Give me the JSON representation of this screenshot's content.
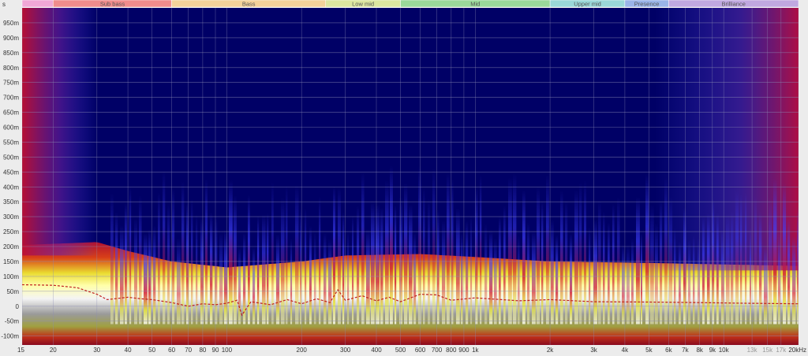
{
  "chart_data": {
    "type": "heatmap",
    "title": "",
    "xlabel": "",
    "ylabel": "",
    "x_scale": "log",
    "x_unit": "Hz",
    "y_unit": "ms",
    "corner_label": "s",
    "xlim_hz": [
      15,
      20000
    ],
    "ylim_ms": [
      -130,
      1000
    ],
    "x_ticks": [
      {
        "hz": 15,
        "label": "15"
      },
      {
        "hz": 20,
        "label": "20"
      },
      {
        "hz": 30,
        "label": "30"
      },
      {
        "hz": 40,
        "label": "40"
      },
      {
        "hz": 50,
        "label": "50"
      },
      {
        "hz": 60,
        "label": "60"
      },
      {
        "hz": 70,
        "label": "70"
      },
      {
        "hz": 80,
        "label": "80"
      },
      {
        "hz": 90,
        "label": "90"
      },
      {
        "hz": 100,
        "label": "100"
      },
      {
        "hz": 200,
        "label": "200"
      },
      {
        "hz": 300,
        "label": "300"
      },
      {
        "hz": 400,
        "label": "400"
      },
      {
        "hz": 500,
        "label": "500"
      },
      {
        "hz": 600,
        "label": "600"
      },
      {
        "hz": 700,
        "label": "700"
      },
      {
        "hz": 800,
        "label": "800"
      },
      {
        "hz": 900,
        "label": "900"
      },
      {
        "hz": 1000,
        "label": "1k"
      },
      {
        "hz": 2000,
        "label": "2k"
      },
      {
        "hz": 3000,
        "label": "3k"
      },
      {
        "hz": 4000,
        "label": "4k"
      },
      {
        "hz": 5000,
        "label": "5k"
      },
      {
        "hz": 6000,
        "label": "6k"
      },
      {
        "hz": 7000,
        "label": "7k"
      },
      {
        "hz": 8000,
        "label": "8k"
      },
      {
        "hz": 9000,
        "label": "9k"
      },
      {
        "hz": 10000,
        "label": "10k"
      },
      {
        "hz": 13000,
        "label": "13k"
      },
      {
        "hz": 15000,
        "label": "15k"
      },
      {
        "hz": 17000,
        "label": "17k"
      },
      {
        "hz": 20000,
        "label": "20kHz"
      }
    ],
    "y_ticks": [
      {
        "ms": 950,
        "label": "950m"
      },
      {
        "ms": 900,
        "label": "900m"
      },
      {
        "ms": 850,
        "label": "850m"
      },
      {
        "ms": 800,
        "label": "800m"
      },
      {
        "ms": 750,
        "label": "750m"
      },
      {
        "ms": 700,
        "label": "700m"
      },
      {
        "ms": 650,
        "label": "650m"
      },
      {
        "ms": 600,
        "label": "600m"
      },
      {
        "ms": 550,
        "label": "550m"
      },
      {
        "ms": 500,
        "label": "500m"
      },
      {
        "ms": 450,
        "label": "450m"
      },
      {
        "ms": 400,
        "label": "400m"
      },
      {
        "ms": 350,
        "label": "350m"
      },
      {
        "ms": 300,
        "label": "300m"
      },
      {
        "ms": 250,
        "label": "250m"
      },
      {
        "ms": 200,
        "label": "200m"
      },
      {
        "ms": 150,
        "label": "150m"
      },
      {
        "ms": 100,
        "label": "100m"
      },
      {
        "ms": 50,
        "label": "50m"
      },
      {
        "ms": 0,
        "label": "0"
      },
      {
        "ms": -50,
        "label": "-50m"
      },
      {
        "ms": -100,
        "label": "-100m"
      }
    ],
    "bands": [
      {
        "label": "",
        "from_hz": 15,
        "to_hz": 20,
        "color": "#f0a8d6"
      },
      {
        "label": "Sub bass",
        "from_hz": 20,
        "to_hz": 60,
        "color": "#f08c8c"
      },
      {
        "label": "Bass",
        "from_hz": 60,
        "to_hz": 250,
        "color": "#f3d29a"
      },
      {
        "label": "Low mid",
        "from_hz": 250,
        "to_hz": 500,
        "color": "#dce6a0"
      },
      {
        "label": "Mid",
        "from_hz": 500,
        "to_hz": 2000,
        "color": "#9ad99a"
      },
      {
        "label": "Upper mid",
        "from_hz": 2000,
        "to_hz": 4000,
        "color": "#9ad8d8"
      },
      {
        "label": "Presence",
        "from_hz": 4000,
        "to_hz": 6000,
        "color": "#9ab4e8"
      },
      {
        "label": "Brilliance",
        "from_hz": 6000,
        "to_hz": 20000,
        "color": "#c0a8e0"
      }
    ],
    "group_delay_ms": [
      {
        "hz": 15,
        "ms": 72
      },
      {
        "hz": 20,
        "ms": 70
      },
      {
        "hz": 25,
        "ms": 62
      },
      {
        "hz": 30,
        "ms": 40
      },
      {
        "hz": 33,
        "ms": 22
      },
      {
        "hz": 40,
        "ms": 30
      },
      {
        "hz": 45,
        "ms": 25
      },
      {
        "hz": 50,
        "ms": 22
      },
      {
        "hz": 60,
        "ms": 12
      },
      {
        "hz": 70,
        "ms": 0
      },
      {
        "hz": 80,
        "ms": 8
      },
      {
        "hz": 90,
        "ms": 5
      },
      {
        "hz": 100,
        "ms": 10
      },
      {
        "hz": 110,
        "ms": 20
      },
      {
        "hz": 115,
        "ms": -30
      },
      {
        "hz": 125,
        "ms": 15
      },
      {
        "hz": 150,
        "ms": 5
      },
      {
        "hz": 175,
        "ms": 22
      },
      {
        "hz": 200,
        "ms": 8
      },
      {
        "hz": 230,
        "ms": 25
      },
      {
        "hz": 260,
        "ms": 12
      },
      {
        "hz": 280,
        "ms": 55
      },
      {
        "hz": 300,
        "ms": 20
      },
      {
        "hz": 350,
        "ms": 35
      },
      {
        "hz": 400,
        "ms": 18
      },
      {
        "hz": 450,
        "ms": 30
      },
      {
        "hz": 500,
        "ms": 15
      },
      {
        "hz": 600,
        "ms": 40
      },
      {
        "hz": 700,
        "ms": 38
      },
      {
        "hz": 800,
        "ms": 20
      },
      {
        "hz": 1000,
        "ms": 28
      },
      {
        "hz": 1500,
        "ms": 18
      },
      {
        "hz": 2000,
        "ms": 22
      },
      {
        "hz": 3000,
        "ms": 15
      },
      {
        "hz": 5000,
        "ms": 14
      },
      {
        "hz": 8000,
        "ms": 12
      },
      {
        "hz": 12000,
        "ms": 10
      },
      {
        "hz": 20000,
        "ms": 8
      }
    ],
    "decay_profile_ms": [
      {
        "hz": 15,
        "ms": 205
      },
      {
        "hz": 30,
        "ms": 215
      },
      {
        "hz": 40,
        "ms": 185
      },
      {
        "hz": 60,
        "ms": 150
      },
      {
        "hz": 100,
        "ms": 130
      },
      {
        "hz": 200,
        "ms": 150
      },
      {
        "hz": 300,
        "ms": 170
      },
      {
        "hz": 600,
        "ms": 175
      },
      {
        "hz": 1000,
        "ms": 165
      },
      {
        "hz": 2000,
        "ms": 150
      },
      {
        "hz": 5000,
        "ms": 145
      },
      {
        "hz": 10000,
        "ms": 140
      },
      {
        "hz": 20000,
        "ms": 135
      }
    ],
    "palette": {
      "background": "#000066",
      "low": "#3a3ae0",
      "mid_low": "#c01030",
      "mid": "#d03818",
      "mid_high": "#eaea30",
      "high": "#ffffa0",
      "peak": "#f2f2f2",
      "sub": "#8a8a8a",
      "group_delay_line": "#c02020",
      "grid": "#8c8cb4"
    },
    "grid": true
  }
}
